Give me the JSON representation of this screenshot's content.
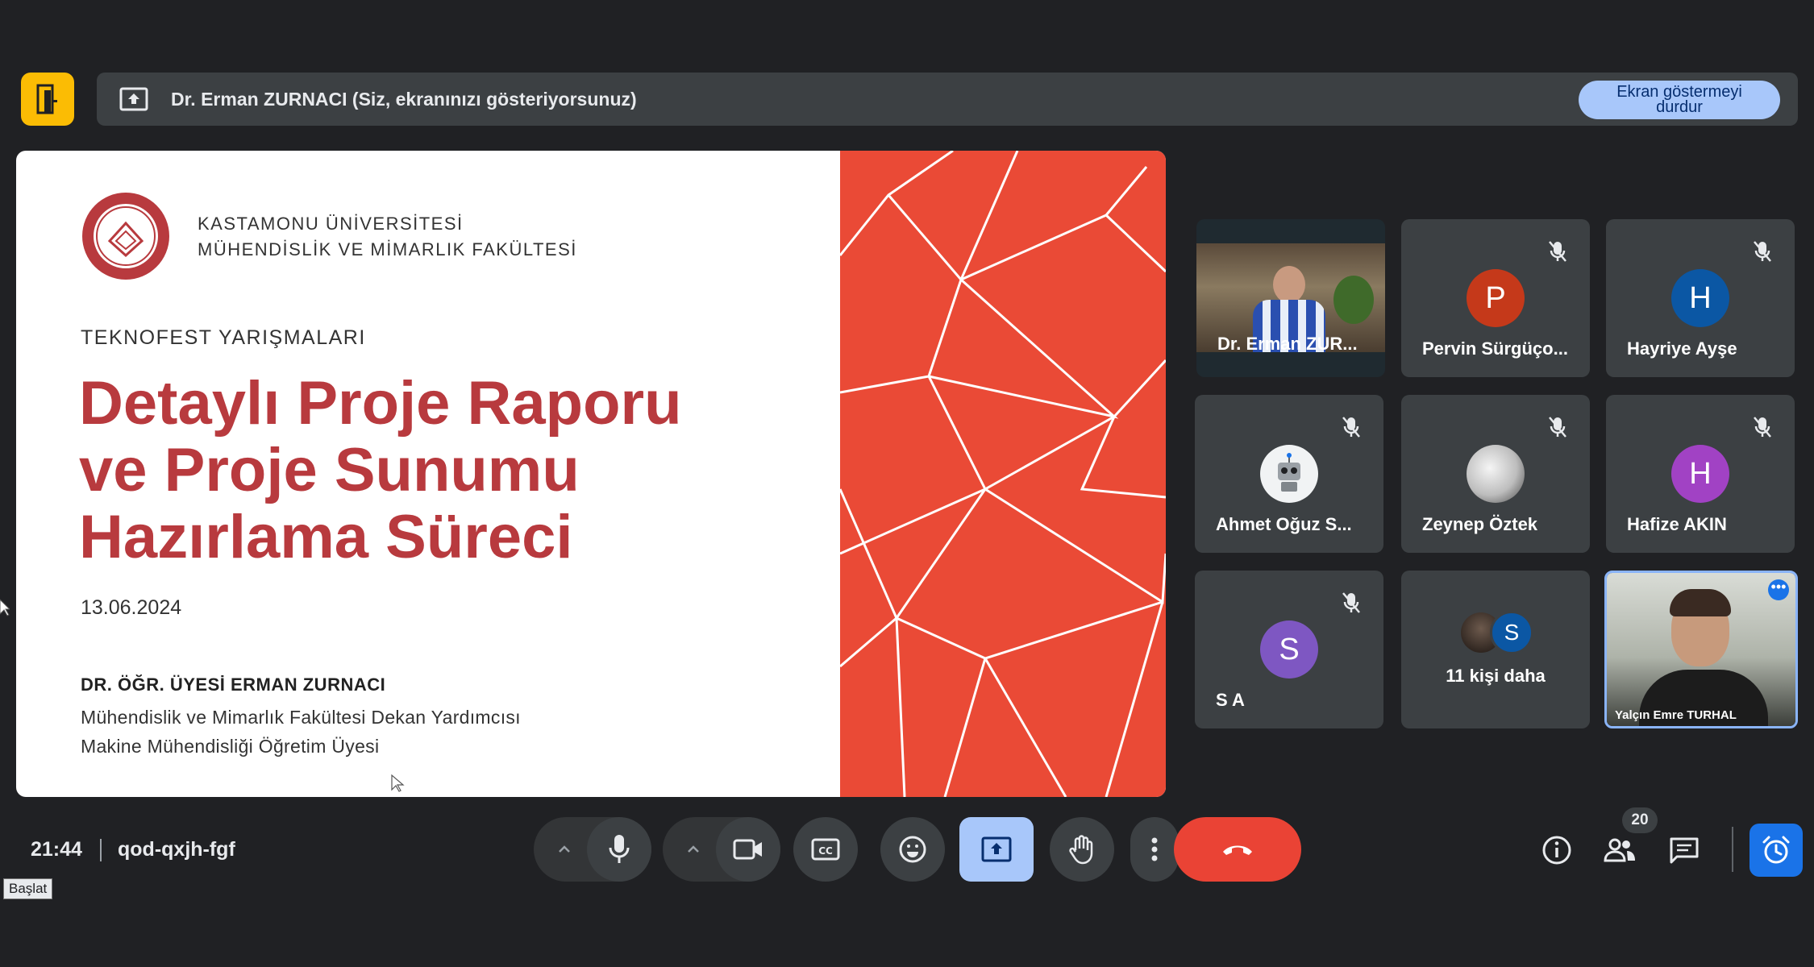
{
  "banner": {
    "text": "Dr. Erman ZURNACI (Siz, ekranınızı gösteriyorsunuz)",
    "stop_button": "Ekran göstermeyi durdur"
  },
  "slide": {
    "university_line1": "KASTAMONU ÜNİVERSİTESİ",
    "university_line2": "MÜHENDİSLİK VE MİMARLIK FAKÜLTESİ",
    "event": "TEKNOFEST YARIŞMALARI",
    "title_line1": "Detaylı Proje Raporu",
    "title_line2": "ve Proje Sunumu",
    "title_line3": "Hazırlama Süreci",
    "date": "13.06.2024",
    "presenter": "DR. ÖĞR. ÜYESİ ERMAN ZURNACI",
    "role1": "Mühendislik ve Mimarlık Fakültesi Dekan Yardımcısı",
    "role2": "Makine Mühendisliği Öğretim Üyesi"
  },
  "participants": [
    {
      "name": "Dr. Erman ZUR...",
      "type": "video"
    },
    {
      "name": "Pervin Sürgüço...",
      "initial": "P",
      "color": "#c5391a",
      "muted": true
    },
    {
      "name": "Hayriye Ayşe",
      "initial": "H",
      "color": "#0b57a4",
      "muted": true
    },
    {
      "name": "Ahmet Oğuz S...",
      "type": "robot",
      "muted": true
    },
    {
      "name": "Zeynep Öztek",
      "type": "photo",
      "muted": true
    },
    {
      "name": "Hafize AKIN",
      "initial": "H",
      "color": "#a142c4",
      "muted": true
    },
    {
      "name": "S A",
      "initial": "S",
      "color": "#7e57c2",
      "muted": true
    },
    {
      "name": "11 kişi daha",
      "type": "others",
      "initial": "S"
    },
    {
      "name": "Yalçın Emre TURHAL",
      "type": "speaker-video"
    }
  ],
  "bottom": {
    "time": "21:44",
    "meeting_code": "qod-qxjh-fgf",
    "participant_count": "20",
    "tooltip": "Başlat"
  },
  "colors": {
    "background": "#202124",
    "accent_blue": "#a8c7fa",
    "end_call_red": "#ea4335",
    "app_badge": "#fbbc04",
    "slide_red": "#ea4a36",
    "title_red": "#b83a3e"
  }
}
